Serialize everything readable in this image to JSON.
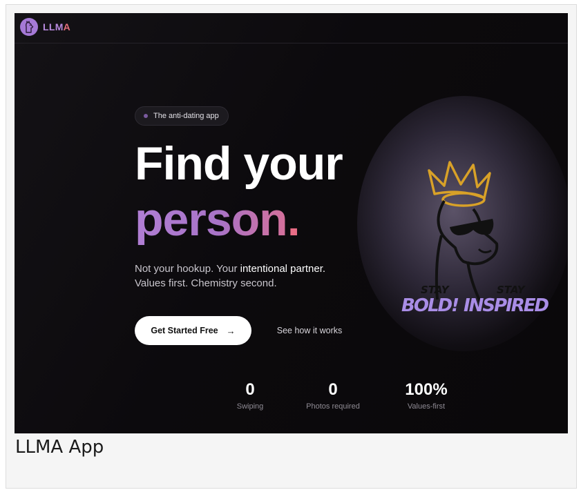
{
  "nav": {
    "brand_part1": "LLM",
    "brand_part2": "A"
  },
  "hero": {
    "badge": "The anti-dating app",
    "headline_line1": "Find your",
    "headline_line2": "person",
    "headline_line2_dot": ".",
    "subtitle_part1": "Not your hookup. Your ",
    "subtitle_highlight": "intentional partner.",
    "subtitle_line2": "Values first. Chemistry second.",
    "cta_primary": "Get Started Free",
    "cta_primary_icon": "→",
    "cta_secondary": "See how it works"
  },
  "stats": [
    {
      "value": "0",
      "label": "Swiping"
    },
    {
      "value": "0",
      "label": "Photos required"
    },
    {
      "value": "100%",
      "label": "Values-first"
    }
  ],
  "illustration": {
    "text_left_small": "STAY",
    "text_right_small": "STAY",
    "text_left_big": "BOLD!",
    "text_right_big": "INSPIRED"
  },
  "caption": "LLMA App",
  "colors": {
    "accent_purple": "#a873c7",
    "accent_pink": "#e96d86",
    "background": "#0b090b"
  },
  "icons": {
    "logo": "llama-logo-icon",
    "cta": "arrow-right-icon",
    "hero_image": "llama-crown-sunglasses-illustration"
  }
}
